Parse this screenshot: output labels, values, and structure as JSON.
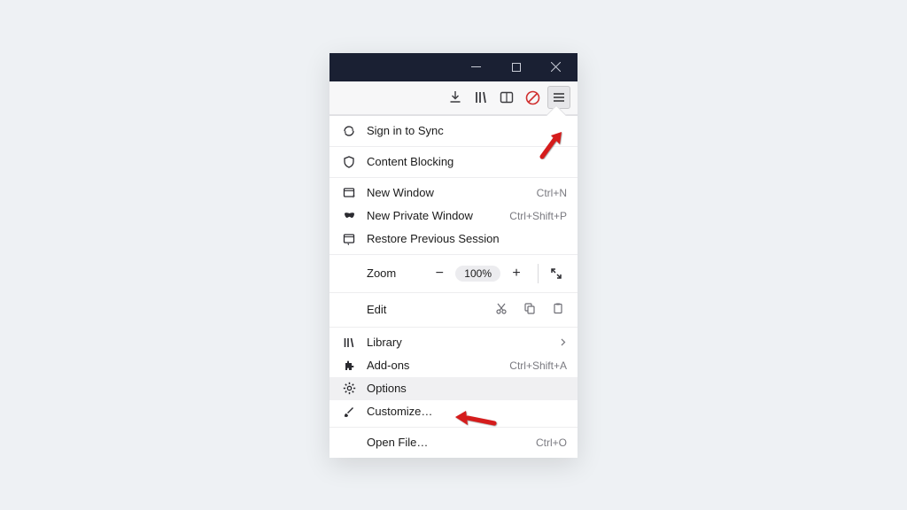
{
  "menu": {
    "sign_in": "Sign in to Sync",
    "content_blocking": "Content Blocking",
    "new_window": "New Window",
    "new_window_sc": "Ctrl+N",
    "new_private": "New Private Window",
    "new_private_sc": "Ctrl+Shift+P",
    "restore": "Restore Previous Session",
    "zoom_label": "Zoom",
    "zoom_pct": "100%",
    "edit_label": "Edit",
    "library": "Library",
    "addons": "Add-ons",
    "addons_sc": "Ctrl+Shift+A",
    "options": "Options",
    "customize": "Customize…",
    "open_file": "Open File…",
    "open_file_sc": "Ctrl+O"
  }
}
